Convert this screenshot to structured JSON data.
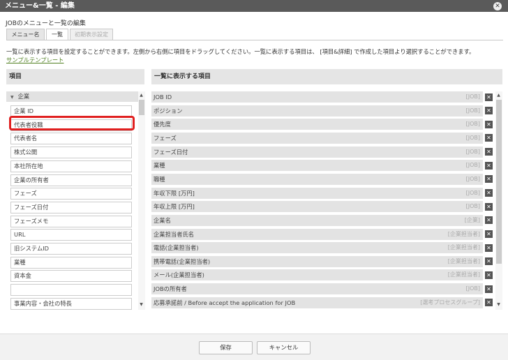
{
  "window": {
    "title": "メニュー&一覧 - 編集",
    "close_glyph": "✕"
  },
  "dialog": {
    "subtitle": "JOBのメニューと一覧の編集"
  },
  "tabs": [
    {
      "label": "メニュー名",
      "state": "normal"
    },
    {
      "label": "一覧",
      "state": "active"
    },
    {
      "label": "初期表示設定",
      "state": "disabled"
    }
  ],
  "description": "一覧に表示する項目を設定することができます。左側から右側に項目をドラッグしてください。一覧に表示する項目は、 [項目&詳細] で作成した項目より選択することができます。",
  "template_link": "サンプルテンプレート",
  "left_panel": {
    "header": "項目",
    "group": {
      "toggle": "▼",
      "label": "企業"
    },
    "items": [
      "企業 ID",
      "代表者役職",
      "代表者名",
      "株式公開",
      "本社所在地",
      "企業の所有者",
      "フェーズ",
      "フェーズ日付",
      "フェーズメモ",
      "URL",
      "旧システムID",
      "業種",
      "資本金",
      "",
      "事業内容・会社の特長"
    ]
  },
  "right_panel": {
    "header": "一覧に表示する項目",
    "items": [
      {
        "label": "JOB ID",
        "tag": "[JOB]"
      },
      {
        "label": "ポジション",
        "tag": "[JOB]"
      },
      {
        "label": "優先度",
        "tag": "[JOB]"
      },
      {
        "label": "フェーズ",
        "tag": "[JOB]"
      },
      {
        "label": "フェーズ日付",
        "tag": "[JOB]"
      },
      {
        "label": "業種",
        "tag": "[JOB]"
      },
      {
        "label": "職種",
        "tag": "[JOB]"
      },
      {
        "label": "年収下限 [万円]",
        "tag": "[JOB]"
      },
      {
        "label": "年収上限 [万円]",
        "tag": "[JOB]"
      },
      {
        "label": "企業名",
        "tag": "[企業]"
      },
      {
        "label": "企業担当者氏名",
        "tag": "[企業担当者]"
      },
      {
        "label": "電話(企業担当者)",
        "tag": "[企業担当者]"
      },
      {
        "label": "携帯電話(企業担当者)",
        "tag": "[企業担当者]"
      },
      {
        "label": "メール(企業担当者)",
        "tag": "[企業担当者]"
      },
      {
        "label": "JOBの所有者",
        "tag": "[JOB]"
      },
      {
        "label": "応募承諾前 / Before accept the application for JOB",
        "tag": "[選考プロセスグループ]"
      }
    ],
    "remove_glyph": "✕"
  },
  "footer": {
    "save": "保存",
    "cancel": "キャンセル"
  },
  "scroll_glyphs": {
    "up": "▲",
    "down": "▼"
  },
  "colors": {
    "titlebar": "#5a5a5a",
    "highlight": "#e02020",
    "link": "#4f7f1f"
  }
}
